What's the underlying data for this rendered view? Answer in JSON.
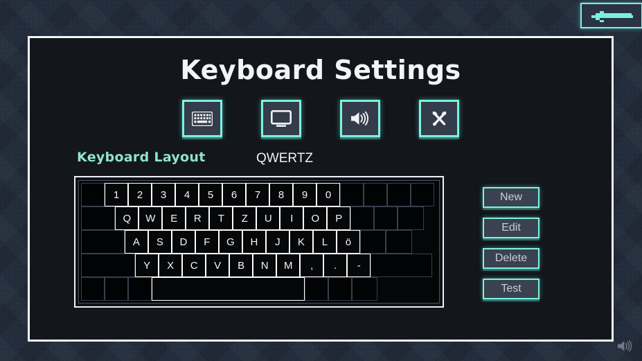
{
  "window": {
    "title": "Keyboard Settings"
  },
  "back_button": {
    "icon": "back-arrow-icon",
    "label": ""
  },
  "tabs": [
    {
      "id": "keyboard",
      "icon": "keyboard-icon",
      "selected": true
    },
    {
      "id": "display",
      "icon": "monitor-icon",
      "selected": false
    },
    {
      "id": "audio",
      "icon": "speaker-icon",
      "selected": false
    },
    {
      "id": "tools",
      "icon": "tools-icon",
      "selected": false
    }
  ],
  "settings": {
    "layout_label": "Keyboard Layout",
    "layout_value": "QWERTZ"
  },
  "keyboard_preview": {
    "columns": 16,
    "rows": [
      {
        "cells": [
          {
            "t": "slot",
            "w": 1
          },
          {
            "t": "key",
            "w": 1,
            "label": "1"
          },
          {
            "t": "key",
            "w": 1,
            "label": "2"
          },
          {
            "t": "key",
            "w": 1,
            "label": "3"
          },
          {
            "t": "key",
            "w": 1,
            "label": "4"
          },
          {
            "t": "key",
            "w": 1,
            "label": "5"
          },
          {
            "t": "key",
            "w": 1,
            "label": "6"
          },
          {
            "t": "key",
            "w": 1,
            "label": "7"
          },
          {
            "t": "key",
            "w": 1,
            "label": "8"
          },
          {
            "t": "key",
            "w": 1,
            "label": "9"
          },
          {
            "t": "key",
            "w": 1,
            "label": "0"
          },
          {
            "t": "slot",
            "w": 1
          },
          {
            "t": "slot",
            "w": 1
          },
          {
            "t": "slot",
            "w": 1
          },
          {
            "t": "slot",
            "w": 1
          }
        ]
      },
      {
        "cells": [
          {
            "t": "slot",
            "w": 1.45
          },
          {
            "t": "key",
            "w": 1,
            "label": "Q"
          },
          {
            "t": "key",
            "w": 1,
            "label": "W"
          },
          {
            "t": "key",
            "w": 1,
            "label": "E"
          },
          {
            "t": "key",
            "w": 1,
            "label": "R"
          },
          {
            "t": "key",
            "w": 1,
            "label": "T"
          },
          {
            "t": "key",
            "w": 1,
            "label": "Z"
          },
          {
            "t": "key",
            "w": 1,
            "label": "U"
          },
          {
            "t": "key",
            "w": 1,
            "label": "I"
          },
          {
            "t": "key",
            "w": 1,
            "label": "O"
          },
          {
            "t": "key",
            "w": 1,
            "label": "P"
          },
          {
            "t": "slot",
            "w": 1
          },
          {
            "t": "slot",
            "w": 1
          },
          {
            "t": "slot",
            "w": 1.1
          }
        ]
      },
      {
        "cells": [
          {
            "t": "slot",
            "w": 1.85
          },
          {
            "t": "key",
            "w": 1,
            "label": "A"
          },
          {
            "t": "key",
            "w": 1,
            "label": "S"
          },
          {
            "t": "key",
            "w": 1,
            "label": "D"
          },
          {
            "t": "key",
            "w": 1,
            "label": "F"
          },
          {
            "t": "key",
            "w": 1,
            "label": "G"
          },
          {
            "t": "key",
            "w": 1,
            "label": "H"
          },
          {
            "t": "key",
            "w": 1,
            "label": "J"
          },
          {
            "t": "key",
            "w": 1,
            "label": "K"
          },
          {
            "t": "key",
            "w": 1,
            "label": "L"
          },
          {
            "t": "key",
            "w": 1,
            "label": "ö"
          },
          {
            "t": "slot",
            "w": 1.1
          },
          {
            "t": "slot",
            "w": 1.1
          }
        ]
      },
      {
        "cells": [
          {
            "t": "slot",
            "w": 2.3
          },
          {
            "t": "key",
            "w": 1,
            "label": "Y"
          },
          {
            "t": "key",
            "w": 1,
            "label": "X"
          },
          {
            "t": "key",
            "w": 1,
            "label": "C"
          },
          {
            "t": "key",
            "w": 1,
            "label": "V"
          },
          {
            "t": "key",
            "w": 1,
            "label": "B"
          },
          {
            "t": "key",
            "w": 1,
            "label": "N"
          },
          {
            "t": "key",
            "w": 1,
            "label": "M"
          },
          {
            "t": "key",
            "w": 1,
            "label": ","
          },
          {
            "t": "key",
            "w": 1,
            "label": "."
          },
          {
            "t": "key",
            "w": 1,
            "label": "-"
          },
          {
            "t": "slot",
            "w": 2.6
          }
        ]
      },
      {
        "cells": [
          {
            "t": "slot",
            "w": 1
          },
          {
            "t": "slot",
            "w": 1
          },
          {
            "t": "slot",
            "w": 1
          },
          {
            "t": "key",
            "w": 6.5,
            "label": ""
          },
          {
            "t": "slot",
            "w": 1
          },
          {
            "t": "slot",
            "w": 1
          },
          {
            "t": "slot",
            "w": 1.1
          }
        ]
      }
    ]
  },
  "actions": [
    {
      "id": "new",
      "label": "New"
    },
    {
      "id": "edit",
      "label": "Edit"
    },
    {
      "id": "delete",
      "label": "Delete"
    },
    {
      "id": "test",
      "label": "Test"
    }
  ],
  "status": {
    "volume_icon": "speaker-icon"
  },
  "colors": {
    "accent_cyan": "#7df3e2",
    "label_mint": "#8fe4cd",
    "panel_bg": "#13161b",
    "desktop_bg": "#232c3b",
    "key_border": "#ffffff",
    "slot_border": "#39404d"
  }
}
